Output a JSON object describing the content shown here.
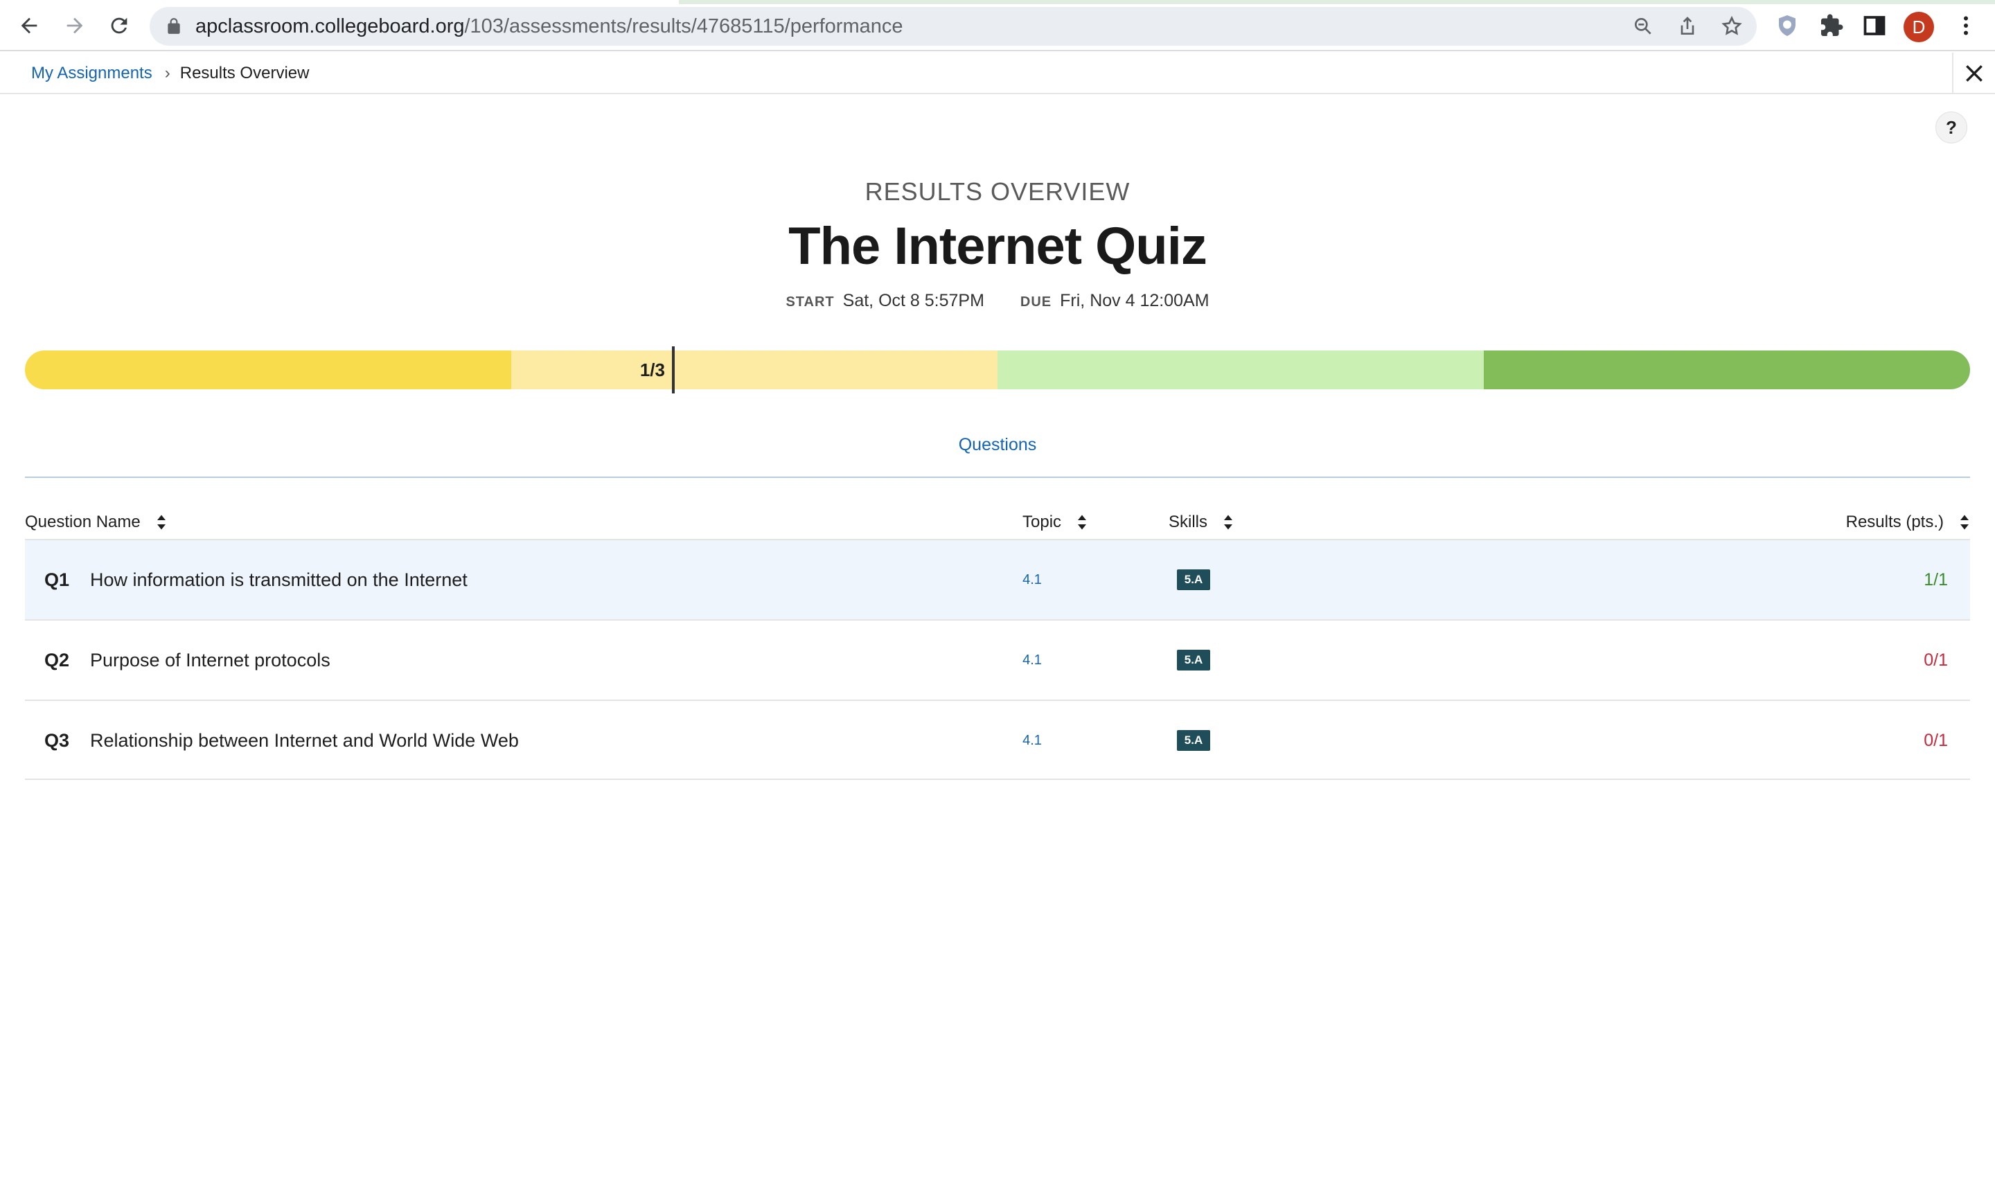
{
  "browser": {
    "url_host": "apclassroom.collegeboard.org",
    "url_path": "/103/assessments/results/47685115/performance",
    "avatar_initial": "D"
  },
  "breadcrumb": {
    "parent": "My Assignments",
    "current": "Results Overview"
  },
  "help": {
    "label": "?"
  },
  "header": {
    "overline": "RESULTS OVERVIEW",
    "title": "The Internet Quiz",
    "start_label": "START",
    "start_value": "Sat, Oct 8 5:57PM",
    "due_label": "DUE",
    "due_value": "Fri, Nov 4 12:00AM"
  },
  "score": {
    "label": "1/3",
    "fraction": 0.3333,
    "segment_colors": [
      "#f9dc4c",
      "#fdeaa3",
      "#caf0b4",
      "#82bd5a"
    ]
  },
  "tabs": {
    "questions": "Questions"
  },
  "table": {
    "columns": {
      "question_name": "Question Name",
      "topic": "Topic",
      "skills": "Skills",
      "results": "Results (pts.)"
    },
    "rows": [
      {
        "num": "Q1",
        "name": "How information is transmitted on the Internet",
        "topic": "4.1",
        "skill": "5.A",
        "result": "1/1",
        "correct": true
      },
      {
        "num": "Q2",
        "name": "Purpose of Internet protocols",
        "topic": "4.1",
        "skill": "5.A",
        "result": "0/1",
        "correct": false
      },
      {
        "num": "Q3",
        "name": "Relationship between Internet and World Wide Web",
        "topic": "4.1",
        "skill": "5.A",
        "result": "0/1",
        "correct": false
      }
    ]
  },
  "colors": {
    "correct": "#3a8a2a",
    "incorrect": "#c8283c",
    "link": "#1464b4"
  }
}
